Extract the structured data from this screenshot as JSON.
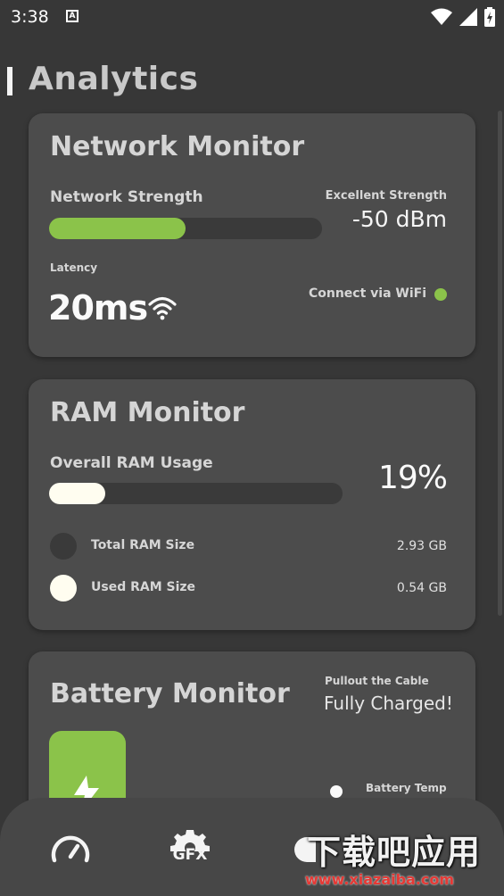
{
  "status": {
    "time": "3:38",
    "notif": "A"
  },
  "page": {
    "title": "Analytics"
  },
  "network": {
    "title": "Network Monitor",
    "strength_label": "Network Strength",
    "strength_quality": "Excellent Strength",
    "strength_value": "-50 dBm",
    "strength_fraction": 0.5,
    "latency_label": "Latency",
    "latency_value": "20ms",
    "connection": "Connect via WiFi",
    "bar_color": "#8bc34a",
    "dot_color": "#8bc34a"
  },
  "ram": {
    "title": "RAM Monitor",
    "usage_label": "Overall RAM Usage",
    "usage_percent": "19%",
    "usage_fraction": 0.19,
    "total_label": "Total RAM Size",
    "total_value": "2.93 GB",
    "used_label": "Used RAM Size",
    "used_value": "0.54 GB",
    "bar_color": "#fffdf0"
  },
  "battery": {
    "title": "Battery Monitor",
    "hint": "Pullout the Cable",
    "status": "Fully Charged!",
    "temp_label": "Battery Temp",
    "level_color": "#8bc34a"
  },
  "nav": {
    "gfx_label": "GFX"
  },
  "watermark": {
    "brand": "下载吧应用",
    "url": "www.xiazaiba.com"
  }
}
